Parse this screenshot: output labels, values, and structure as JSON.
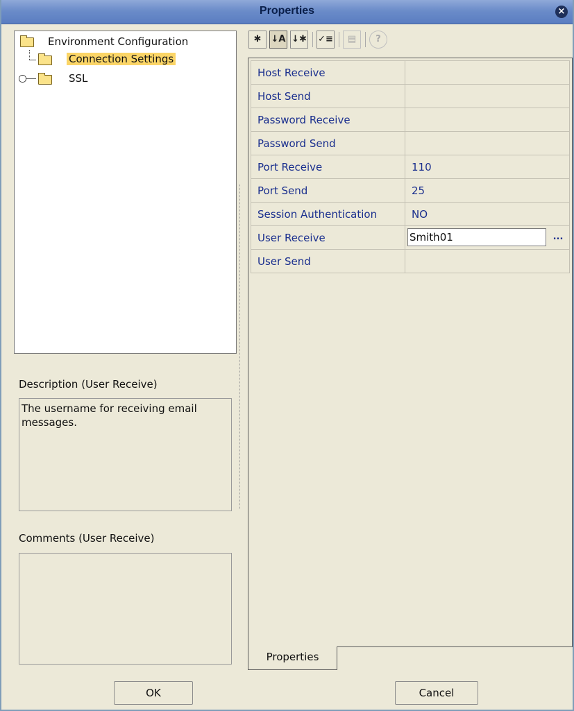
{
  "window": {
    "title": "Properties",
    "close_symbol": "×"
  },
  "tree": {
    "root_label": "Environment Configuration",
    "children": [
      {
        "label": "Connection Settings",
        "selected": true
      },
      {
        "label": "SSL",
        "selected": false
      }
    ]
  },
  "description": {
    "label": "Description (User Receive)",
    "text": "The username for receiving email messages."
  },
  "comments": {
    "label": "Comments (User Receive)",
    "text": ""
  },
  "toolbar": {
    "buttons": [
      {
        "icon": "categorized-icon",
        "glyph": "✱"
      },
      {
        "icon": "sort-az-icon",
        "glyph": "↓A"
      },
      {
        "icon": "sort-custom-icon",
        "glyph": "↓✱"
      },
      {
        "icon": "checklist-icon",
        "glyph": "✓≡"
      },
      {
        "icon": "property-page-icon",
        "glyph": "▤"
      },
      {
        "icon": "help-icon",
        "glyph": "?"
      }
    ]
  },
  "properties": {
    "rows": [
      {
        "name": "Host Receive",
        "value": ""
      },
      {
        "name": "Host Send",
        "value": ""
      },
      {
        "name": "Password Receive",
        "value": ""
      },
      {
        "name": "Password Send",
        "value": ""
      },
      {
        "name": "Port Receive",
        "value": "110"
      },
      {
        "name": "Port Send",
        "value": "25"
      },
      {
        "name": "Session Authentication",
        "value": "NO"
      },
      {
        "name": "User Receive",
        "value": "Smith01",
        "editing": true,
        "ellipsis": "..."
      },
      {
        "name": "User Send",
        "value": ""
      }
    ],
    "tab_label": "Properties"
  },
  "buttons": {
    "ok": "OK",
    "cancel": "Cancel"
  },
  "colors": {
    "accent_title": "#6b8cc9",
    "selection": "#fbd567",
    "property_text": "#1a2f8e"
  }
}
